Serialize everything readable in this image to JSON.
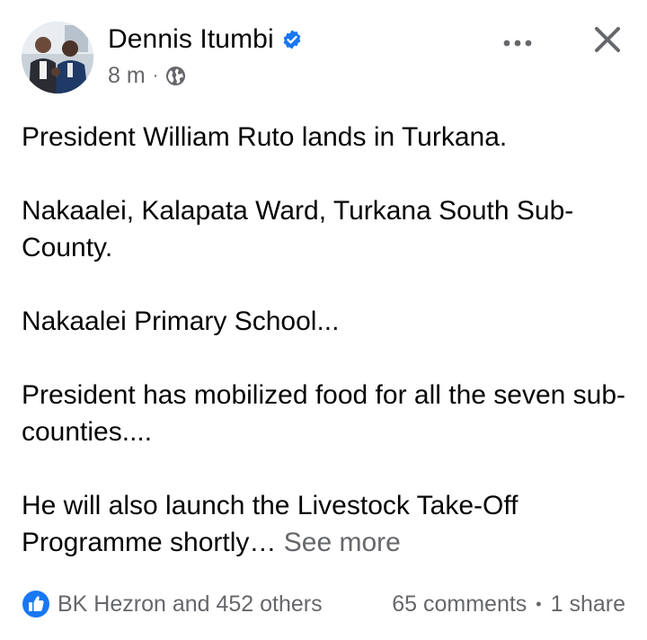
{
  "post": {
    "author": {
      "name": "Dennis Itumbi",
      "verified": true
    },
    "timestamp": "8 m",
    "meta_separator": "·",
    "audience_icon": "globe-icon",
    "body": {
      "paragraphs": [
        "President William Ruto lands in Turkana.",
        "Nakaalei, Kalapata Ward, Turkana South Sub-County.",
        "Nakaalei Primary School...",
        "President has mobilized food for all the seven sub-counties....",
        "He will also launch the Livestock Take-Off Programme shortly…"
      ],
      "see_more": "See more"
    },
    "footer": {
      "reactions": "BK Hezron and 452 others",
      "comments": "65 comments",
      "separator": "•",
      "shares": "1 share"
    }
  },
  "colors": {
    "text_primary": "#050505",
    "text_secondary": "#65676b",
    "accent_blue": "#1877f2",
    "icon_gray": "#65676b"
  },
  "icons": {
    "more": "more-horizontal-icon",
    "close": "close-icon",
    "verified": "verified-badge-icon",
    "like": "like-reaction-icon"
  }
}
